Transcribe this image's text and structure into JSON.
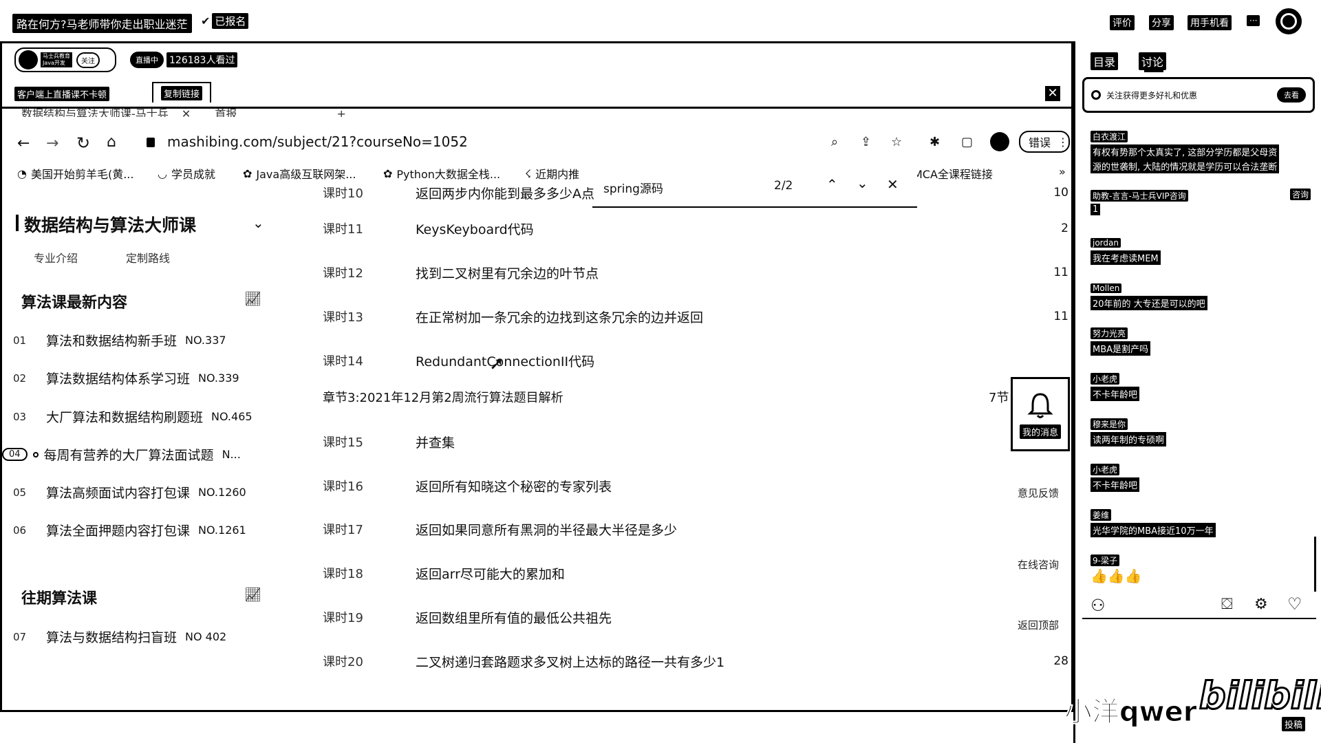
{
  "header": {
    "title": "路在何方?马老师带你走出职业迷茫",
    "registered": "已报名",
    "actions": [
      "评价",
      "分享",
      "用手机看",
      "···"
    ]
  },
  "player_bar": {
    "brand_line1": "马士兵教育",
    "brand_line2": "Java开发",
    "follow": "关注",
    "live_tag": "直播中",
    "viewers": "126183人看过",
    "client_notice": "客户端上直播课不卡顿",
    "tab_label": "复制链接"
  },
  "browser": {
    "tab1": "数据结构与算法大师课-马士兵",
    "tab2": "首报",
    "url": "mashibing.com/subject/21?courseNo=1052",
    "error_btn": "错误",
    "bookmarks": [
      "美国开始剪羊毛(黄...",
      "学员成就",
      "Java高级互联网架...",
      "Python大数据全栈...",
      "近期内推",
      "MCA全课程链接"
    ],
    "find": {
      "query": "spring源码",
      "count": "2/2"
    }
  },
  "sidebar": {
    "course_title": "数据结构与算法大师课",
    "links": [
      "专业介绍",
      "定制路线"
    ],
    "section_new": "算法课最新内容",
    "section_past": "往期算法课",
    "new_courses": [
      {
        "num": "01",
        "name": "算法和数据结构新手班",
        "no": "NO.337"
      },
      {
        "num": "02",
        "name": "算法数据结构体系学习班",
        "no": "NO.339"
      },
      {
        "num": "03",
        "name": "大厂算法和数据结构刷题班",
        "no": "NO.465"
      },
      {
        "num": "04",
        "name": "每周有营养的大厂算法面试题",
        "no": "N..."
      },
      {
        "num": "05",
        "name": "算法高频面试内容打包课",
        "no": "NO.1260"
      },
      {
        "num": "06",
        "name": "算法全面押题内容打包课",
        "no": "NO.1261"
      }
    ],
    "past_courses": [
      {
        "num": "07",
        "name": "算法与数据结构扫盲班",
        "no": "NO 402"
      }
    ]
  },
  "lessons": {
    "partial_top": {
      "idx": "课时10",
      "title": "返回两步内你能到最多多少A点",
      "count": "10"
    },
    "rows": [
      {
        "idx": "课时11",
        "title": "KeysKeyboard代码",
        "count": "2"
      },
      {
        "idx": "课时12",
        "title": "找到二叉树里有冗余边的叶节点",
        "count": "11"
      },
      {
        "idx": "课时13",
        "title": "在正常树加一条冗余的边找到这条冗余的边并返回",
        "count": "11"
      },
      {
        "idx": "课时14",
        "title": "RedundantConnectionII代码",
        "count": ""
      }
    ],
    "chapter": {
      "title": "章节3:2021年12月第2周流行算法题目解析",
      "count": "7节"
    },
    "rows2": [
      {
        "idx": "课时15",
        "title": "并查集",
        "count": ""
      },
      {
        "idx": "课时16",
        "title": "返回所有知晓这个秘密的专家列表",
        "count": ""
      },
      {
        "idx": "课时17",
        "title": "返回如果同意所有黑洞的半径最大半径是多少",
        "count": ""
      },
      {
        "idx": "课时18",
        "title": "返回arr尽可能大的累加和",
        "count": ""
      },
      {
        "idx": "课时19",
        "title": "返回数组里所有值的最低公共祖先",
        "count": ""
      },
      {
        "idx": "课时20",
        "title": "二叉树递归套路题求多叉树上达标的路径一共有多少1",
        "count": "28"
      }
    ]
  },
  "float_tools": {
    "bell_label": "我的消息",
    "feedback": "意见反馈",
    "consult": "在线咨询",
    "back_top": "返回顶部"
  },
  "right_panel": {
    "tabs": [
      "目录",
      "讨论"
    ],
    "promo": "关注获得更多好礼和优惠",
    "promo_btn": "去看",
    "chat": [
      {
        "user": "白衣渡江",
        "msg": [
          "有权有势那个太真实了, 这部分学历都是父母资",
          "源的世袭制, 大陆的情况就是学历可以合法垄断"
        ]
      },
      {
        "user": "助教-言言-马士兵VIP咨询",
        "msg": [
          "1"
        ],
        "tag": "咨询"
      },
      {
        "user": "jordan",
        "msg": [
          "我在考虑读MEM"
        ]
      },
      {
        "user": "Mollen",
        "msg": [
          "20年前的 大专还是可以的吧"
        ]
      },
      {
        "user": "努力光亮",
        "msg": [
          "MBA是割产吗"
        ]
      },
      {
        "user": "小老虎",
        "msg": [
          "不卡年龄吧"
        ]
      },
      {
        "user": "穆来是你",
        "msg": [
          "读两年制的专硕啊"
        ]
      },
      {
        "user": "小老虎",
        "msg": [
          "不卡年龄吧"
        ]
      },
      {
        "user": "姜维",
        "msg": [
          "光华学院的MBA接近10万一年"
        ]
      },
      {
        "user": "9-梁子",
        "msg": [
          "👍👍👍"
        ]
      }
    ]
  },
  "watermark": {
    "uploader": "小洋qwer",
    "site": "bilibili",
    "sub": "投稿"
  }
}
